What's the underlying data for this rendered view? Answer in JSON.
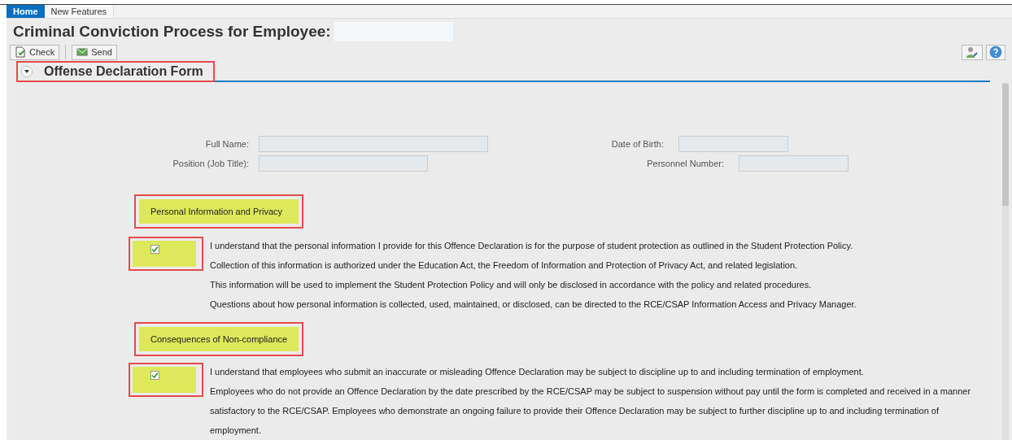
{
  "tabs": [
    {
      "label": "Home",
      "selected": true
    },
    {
      "label": "New Features",
      "selected": false
    }
  ],
  "page_title": "Criminal Conviction Process for Employee:",
  "toolbar": [
    {
      "label": "Check",
      "kind": "check"
    },
    {
      "label": "Send",
      "kind": "send"
    }
  ],
  "section": {
    "title": "Offense Declaration Form",
    "expanded": true
  },
  "fields_left": [
    {
      "label": "Full Name:"
    },
    {
      "label": "Position (Job Title):"
    }
  ],
  "fields_right": [
    {
      "label": "Date of Birth:"
    },
    {
      "label": "Personnel Number:"
    }
  ],
  "groups": [
    {
      "heading": "Personal Information and Privacy",
      "checked": true,
      "lines": [
        "I understand that the personal information I provide for this Offence Declaration is for the purpose of student protection as outlined in the Student Protection Policy.",
        "Collection of this information is authorized under the Education Act, the Freedom of Information and Protection of Privacy Act, and related legislation.",
        "This information will be used to implement the Student Protection Policy and will only be disclosed in accordance with the policy and related procedures.",
        "Questions about how personal information is collected, used, maintained, or disclosed, can be directed to the RCE/CSAP Information Access and Privacy Manager."
      ]
    },
    {
      "heading": "Consequences of Non-compliance",
      "checked": true,
      "lines": [
        "I understand that employees who submit an inaccurate or misleading Offence Declaration may be subject to discipline up to and including termination of employment.",
        "Employees who do not provide an Offence Declaration by the date prescribed by the RCE/CSAP may be subject to suspension without pay until the form is completed and received in a manner satisfactory to the RCE/CSAP. Employees who demonstrate an ongoing failure to provide their Offence Declaration may be subject to further discipline up to and including termination of employment."
      ]
    }
  ]
}
